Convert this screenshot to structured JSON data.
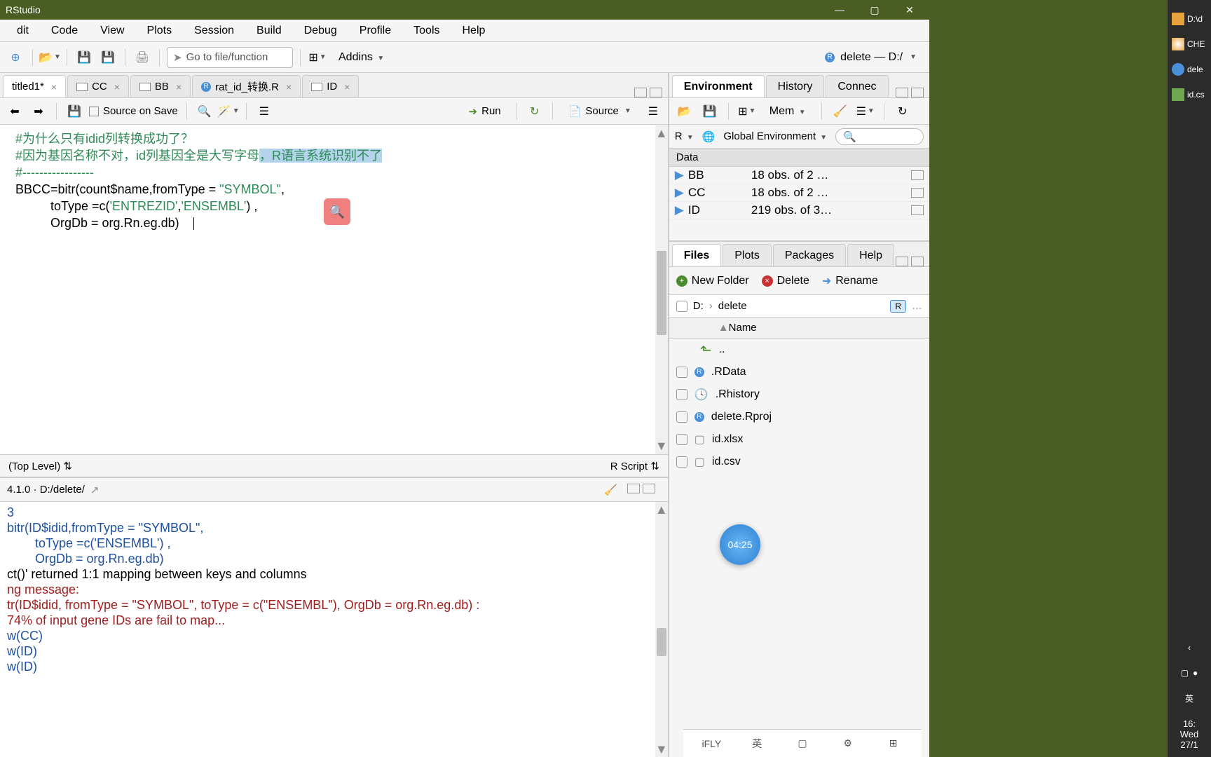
{
  "titlebar": {
    "text": "RStudio"
  },
  "menubar": [
    "dit",
    "Code",
    "View",
    "Plots",
    "Session",
    "Build",
    "Debug",
    "Profile",
    "Tools",
    "Help"
  ],
  "toolbar": {
    "gotofile_placeholder": "Go to file/function",
    "addins_label": "Addins",
    "project_label": "delete — D:/"
  },
  "source_tabs": [
    {
      "label": "titled1*",
      "active": true,
      "icon": null
    },
    {
      "label": "CC",
      "active": false,
      "icon": "table"
    },
    {
      "label": "BB",
      "active": false,
      "icon": "table"
    },
    {
      "label": "rat_id_转换.R",
      "active": false,
      "icon": "r"
    },
    {
      "label": "ID",
      "active": false,
      "icon": "table"
    }
  ],
  "editor_toolbar": {
    "source_on_save": "Source on Save",
    "run_label": "Run",
    "source_label": "Source"
  },
  "editor_code": {
    "l1": "  #为什么只有idid列转换成功了？",
    "l2a": "  #因为基因名称不对，id列基因全是大写字母",
    "l2b": "，R语言系统识别不了",
    "l3": "",
    "l4": "",
    "l5": "  #-----------------",
    "l6a": "  BBCC=bitr(count$name,fromType = ",
    "l6b": "\"SYMBOL\"",
    "l6c": ",",
    "l7a": "            toType =c(",
    "l7b": "'ENTREZID'",
    "l7c": ",",
    "l7d": "'ENSEMBL'",
    "l7e": ") ,",
    "l8": "            OrgDb = org.Rn.eg.db)"
  },
  "editor_footer": {
    "left": "(Top Level)",
    "right": "R Script"
  },
  "console": {
    "header": "4.1.0 · D:/delete/",
    "lines": [
      {
        "cls": "console-blue",
        "text": "3"
      },
      {
        "cls": "console-blue",
        "text": "bitr(ID$idid,fromType = \"SYMBOL\","
      },
      {
        "cls": "console-blue",
        "text": "        toType =c('ENSEMBL') ,"
      },
      {
        "cls": "console-blue",
        "text": "        OrgDb = org.Rn.eg.db)"
      },
      {
        "cls": "",
        "text": "ct()' returned 1:1 mapping between keys and columns"
      },
      {
        "cls": "console-red",
        "text": "ng message:"
      },
      {
        "cls": "console-red",
        "text": "tr(ID$idid, fromType = \"SYMBOL\", toType = c(\"ENSEMBL\"), OrgDb = org.Rn.eg.db) :"
      },
      {
        "cls": "console-red",
        "text": "74% of input gene IDs are fail to map..."
      },
      {
        "cls": "console-blue",
        "text": "w(CC)"
      },
      {
        "cls": "console-blue",
        "text": "w(ID)"
      },
      {
        "cls": "console-blue",
        "text": "w(ID)"
      }
    ]
  },
  "env_tabs": [
    "Environment",
    "History",
    "Connec"
  ],
  "env_toolbar": {
    "mem_label": "Mem"
  },
  "env_scope": {
    "lang": "R",
    "scope": "Global Environment"
  },
  "env_data_header": "Data",
  "env_data": [
    {
      "name": "BB",
      "value": "18 obs. of 2 …"
    },
    {
      "name": "CC",
      "value": "18 obs. of 2 …"
    },
    {
      "name": "ID",
      "value": "219 obs. of 3…"
    }
  ],
  "files_tabs": [
    "Files",
    "Plots",
    "Packages",
    "Help"
  ],
  "files_actions": {
    "new_folder": "New Folder",
    "delete": "Delete",
    "rename": "Rename"
  },
  "files_breadcrumb": [
    "D:",
    "delete"
  ],
  "files_header": "Name",
  "files_list": [
    {
      "name": "..",
      "icon": "up"
    },
    {
      "name": ".RData",
      "icon": "r"
    },
    {
      "name": ".Rhistory",
      "icon": "hist"
    },
    {
      "name": "delete.Rproj",
      "icon": "r"
    },
    {
      "name": "id.xlsx",
      "icon": "doc"
    },
    {
      "name": "id.csv",
      "icon": "doc"
    }
  ],
  "sidebar": [
    {
      "label": "D:\\d",
      "color": "#e8a33d"
    },
    {
      "label": "CHE",
      "color": "#e8a33d"
    },
    {
      "label": "dele",
      "color": "#4a90d9"
    },
    {
      "label": "id.cs",
      "color": "#6ea84f"
    }
  ],
  "floating_timer": "04:25",
  "clock": {
    "time": "16:",
    "day": "Wed",
    "date": "27/1"
  },
  "ime_items": [
    "iFLY",
    "英",
    "▢",
    "⚙",
    "⊞"
  ]
}
